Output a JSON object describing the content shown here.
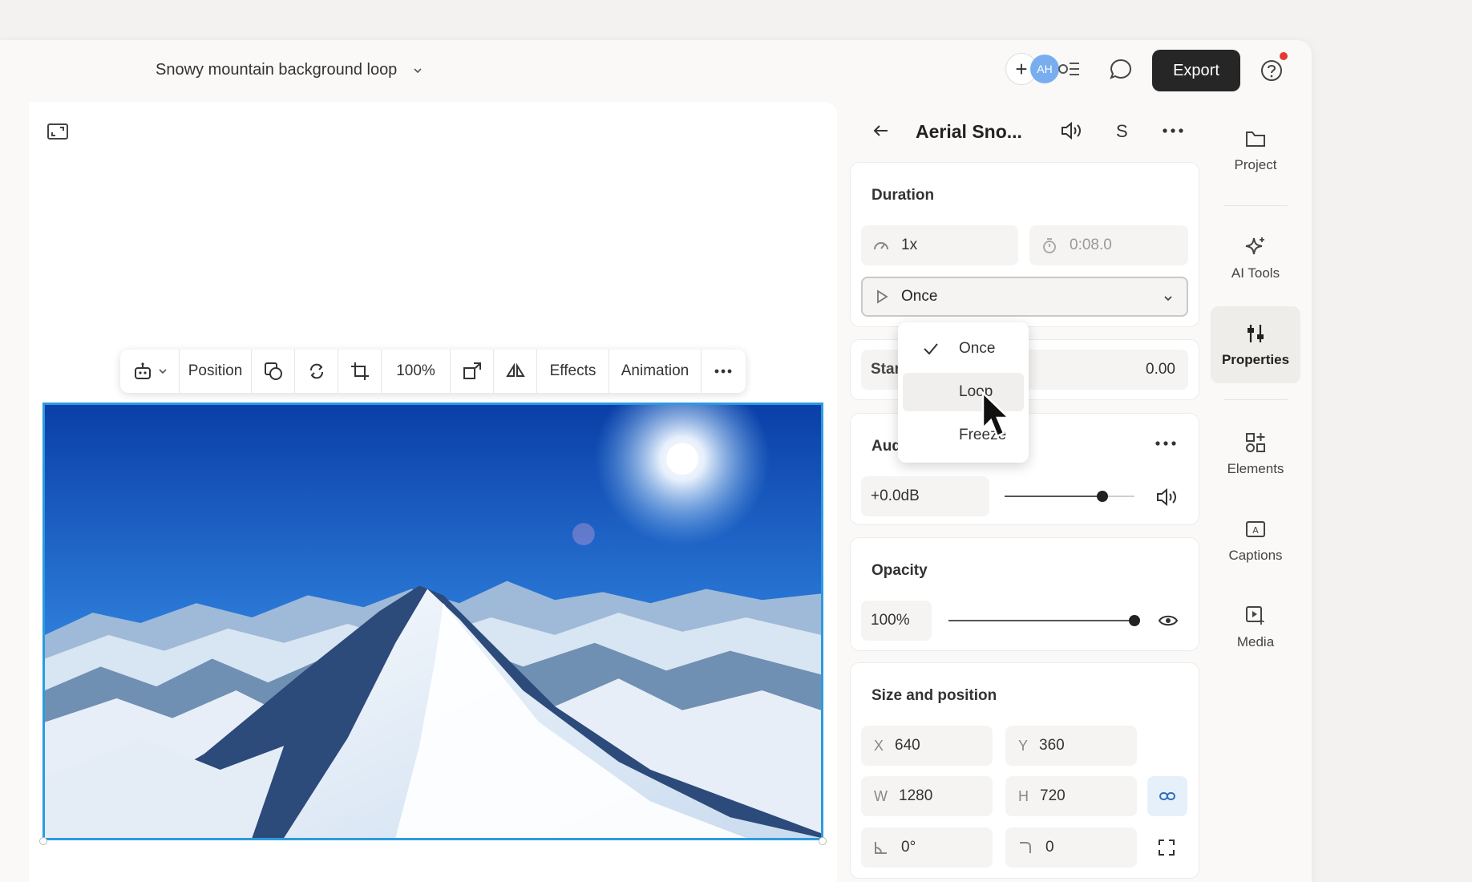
{
  "header": {
    "project_title": "Snowy mountain background loop",
    "avatar_initials": "AH",
    "export_label": "Export"
  },
  "toolbar": {
    "position_label": "Position",
    "zoom": "100%",
    "effects_label": "Effects",
    "animation_label": "Animation"
  },
  "panel": {
    "clip_title": "Aerial Sno...",
    "s_label": "S",
    "duration": {
      "title": "Duration",
      "speed": "1x",
      "time": "0:08.0",
      "playback_selected": "Once"
    },
    "playback_menu": {
      "options": [
        "Once",
        "Loop",
        "Freeze"
      ],
      "checked": "Once",
      "hovered": "Loop"
    },
    "start": {
      "label": "Start",
      "value": "0.00"
    },
    "audio": {
      "title": "Audio",
      "gain": "+0.0dB",
      "level": 0.75
    },
    "opacity": {
      "title": "Opacity",
      "value": "100%",
      "level": 1.0
    },
    "size_position": {
      "title": "Size and position",
      "x_label": "X",
      "x": "640",
      "y_label": "Y",
      "y": "360",
      "w_label": "W",
      "w": "1280",
      "h_label": "H",
      "h": "720",
      "rotation": "0°",
      "corner": "0"
    }
  },
  "rail": {
    "items": [
      {
        "label": "Project",
        "icon": "folder-icon"
      },
      {
        "label": "AI Tools",
        "icon": "sparkle-icon"
      },
      {
        "label": "Properties",
        "icon": "sliders-icon"
      },
      {
        "label": "Elements",
        "icon": "shapes-icon"
      },
      {
        "label": "Captions",
        "icon": "captions-icon"
      },
      {
        "label": "Media",
        "icon": "media-icon"
      }
    ],
    "active": "Properties"
  },
  "colors": {
    "accent": "#2b9be0",
    "export_bg": "#262626",
    "notification": "#e53935"
  }
}
